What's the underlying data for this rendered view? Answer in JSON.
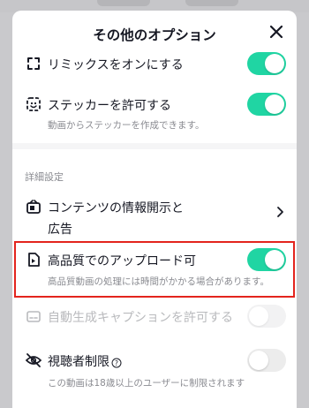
{
  "sheet": {
    "title": "その他のオプション"
  },
  "options": {
    "remix": {
      "label": "リミックスをオンにする",
      "on": true
    },
    "stickers": {
      "label": "ステッカーを許可する",
      "sub": "動画からステッカーを作成できます。",
      "on": true
    },
    "section_label": "詳細設定",
    "disclosure": {
      "label_line1": "コンテンツの情報開示と",
      "label_line2": "広告"
    },
    "hq_upload": {
      "label": "高品質でのアップロード可",
      "sub": "高品質動画の処理には時間がかかる場合があります。",
      "on": true
    },
    "auto_captions": {
      "label": "自動生成キャプションを許可する",
      "on": false,
      "disabled": true
    },
    "audience": {
      "label": "視聴者制限",
      "sub": "この動画は18歳以上のユーザーに制限されます",
      "on": false
    }
  },
  "colors": {
    "toggle_on": "#20d5a3",
    "highlight": "#e3241d",
    "secondary_text": "#8a8b91"
  },
  "icons": {
    "close": "close-icon",
    "remix": "remix-icon",
    "stickers": "sticker-icon",
    "disclosure": "disclosure-icon",
    "hq_upload": "hq-upload-icon",
    "auto_captions": "captions-icon",
    "audience": "restricted-eye-icon",
    "help": "help-icon",
    "chevron": "chevron-right-icon"
  }
}
